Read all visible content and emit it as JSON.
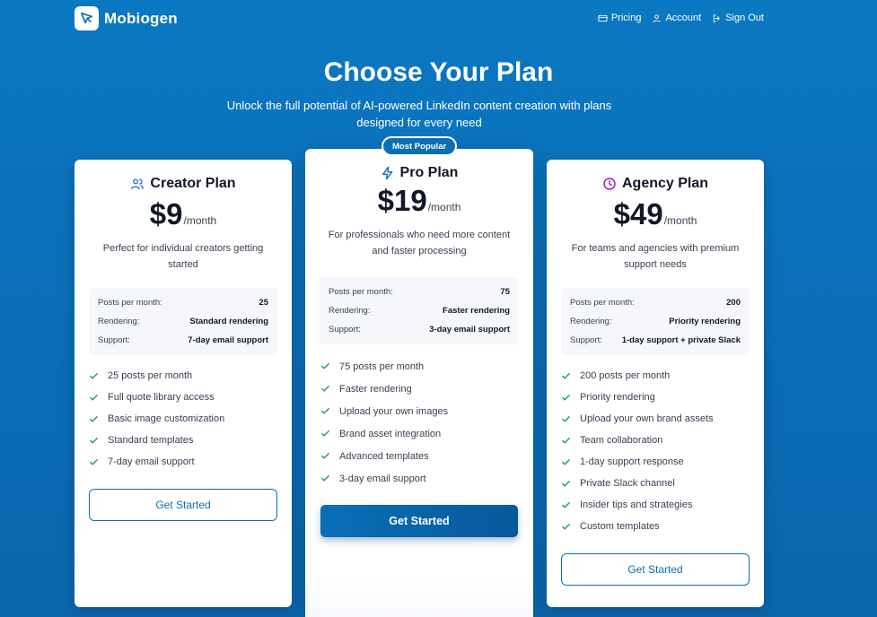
{
  "brand": {
    "name": "Mobiogen"
  },
  "nav": [
    {
      "label": "Pricing",
      "icon": "credit-card-icon"
    },
    {
      "label": "Account",
      "icon": "user-icon"
    },
    {
      "label": "Sign Out",
      "icon": "sign-out-icon"
    }
  ],
  "hero": {
    "title": "Choose Your Plan",
    "subtitle": "Unlock the full potential of AI-powered LinkedIn content creation with plans designed for every need"
  },
  "plans": [
    {
      "name": "Creator Plan",
      "icon": "users-icon",
      "price": "$9",
      "period": "/month",
      "description": "Perfect for individual creators getting started",
      "specs": [
        {
          "label": "Posts per month:",
          "value": "25"
        },
        {
          "label": "Rendering:",
          "value": "Standard rendering"
        },
        {
          "label": "Support:",
          "value": "7-day email support"
        }
      ],
      "features": [
        "25 posts per month",
        "Full quote library access",
        "Basic image customization",
        "Standard templates",
        "7-day email support"
      ],
      "cta": "Get Started"
    },
    {
      "name": "Pro Plan",
      "icon": "lightning-icon",
      "badge": "Most Popular",
      "price": "$19",
      "period": "/month",
      "description": "For professionals who need more content and faster processing",
      "specs": [
        {
          "label": "Posts per month:",
          "value": "75"
        },
        {
          "label": "Rendering:",
          "value": "Faster rendering"
        },
        {
          "label": "Support:",
          "value": "3-day email support"
        }
      ],
      "features": [
        "75 posts per month",
        "Faster rendering",
        "Upload your own images",
        "Brand asset integration",
        "Advanced templates",
        "3-day email support"
      ],
      "cta": "Get Started"
    },
    {
      "name": "Agency Plan",
      "icon": "clock-icon",
      "price": "$49",
      "period": "/month",
      "description": "For teams and agencies with premium support needs",
      "specs": [
        {
          "label": "Posts per month:",
          "value": "200"
        },
        {
          "label": "Rendering:",
          "value": "Priority rendering"
        },
        {
          "label": "Support:",
          "value": "1-day support + private Slack"
        }
      ],
      "features": [
        "200 posts per month",
        "Priority rendering",
        "Upload your own brand assets",
        "Team collaboration",
        "1-day support response",
        "Private Slack channel",
        "Insider tips and strategies",
        "Custom templates"
      ],
      "cta": "Get Started"
    }
  ],
  "colors": {
    "accent": "#0b6fb3",
    "check": "#16a34a",
    "agency_icon": "#a21caf",
    "pro_icon": "#0b6fb3",
    "creator_icon": "#2563eb"
  }
}
